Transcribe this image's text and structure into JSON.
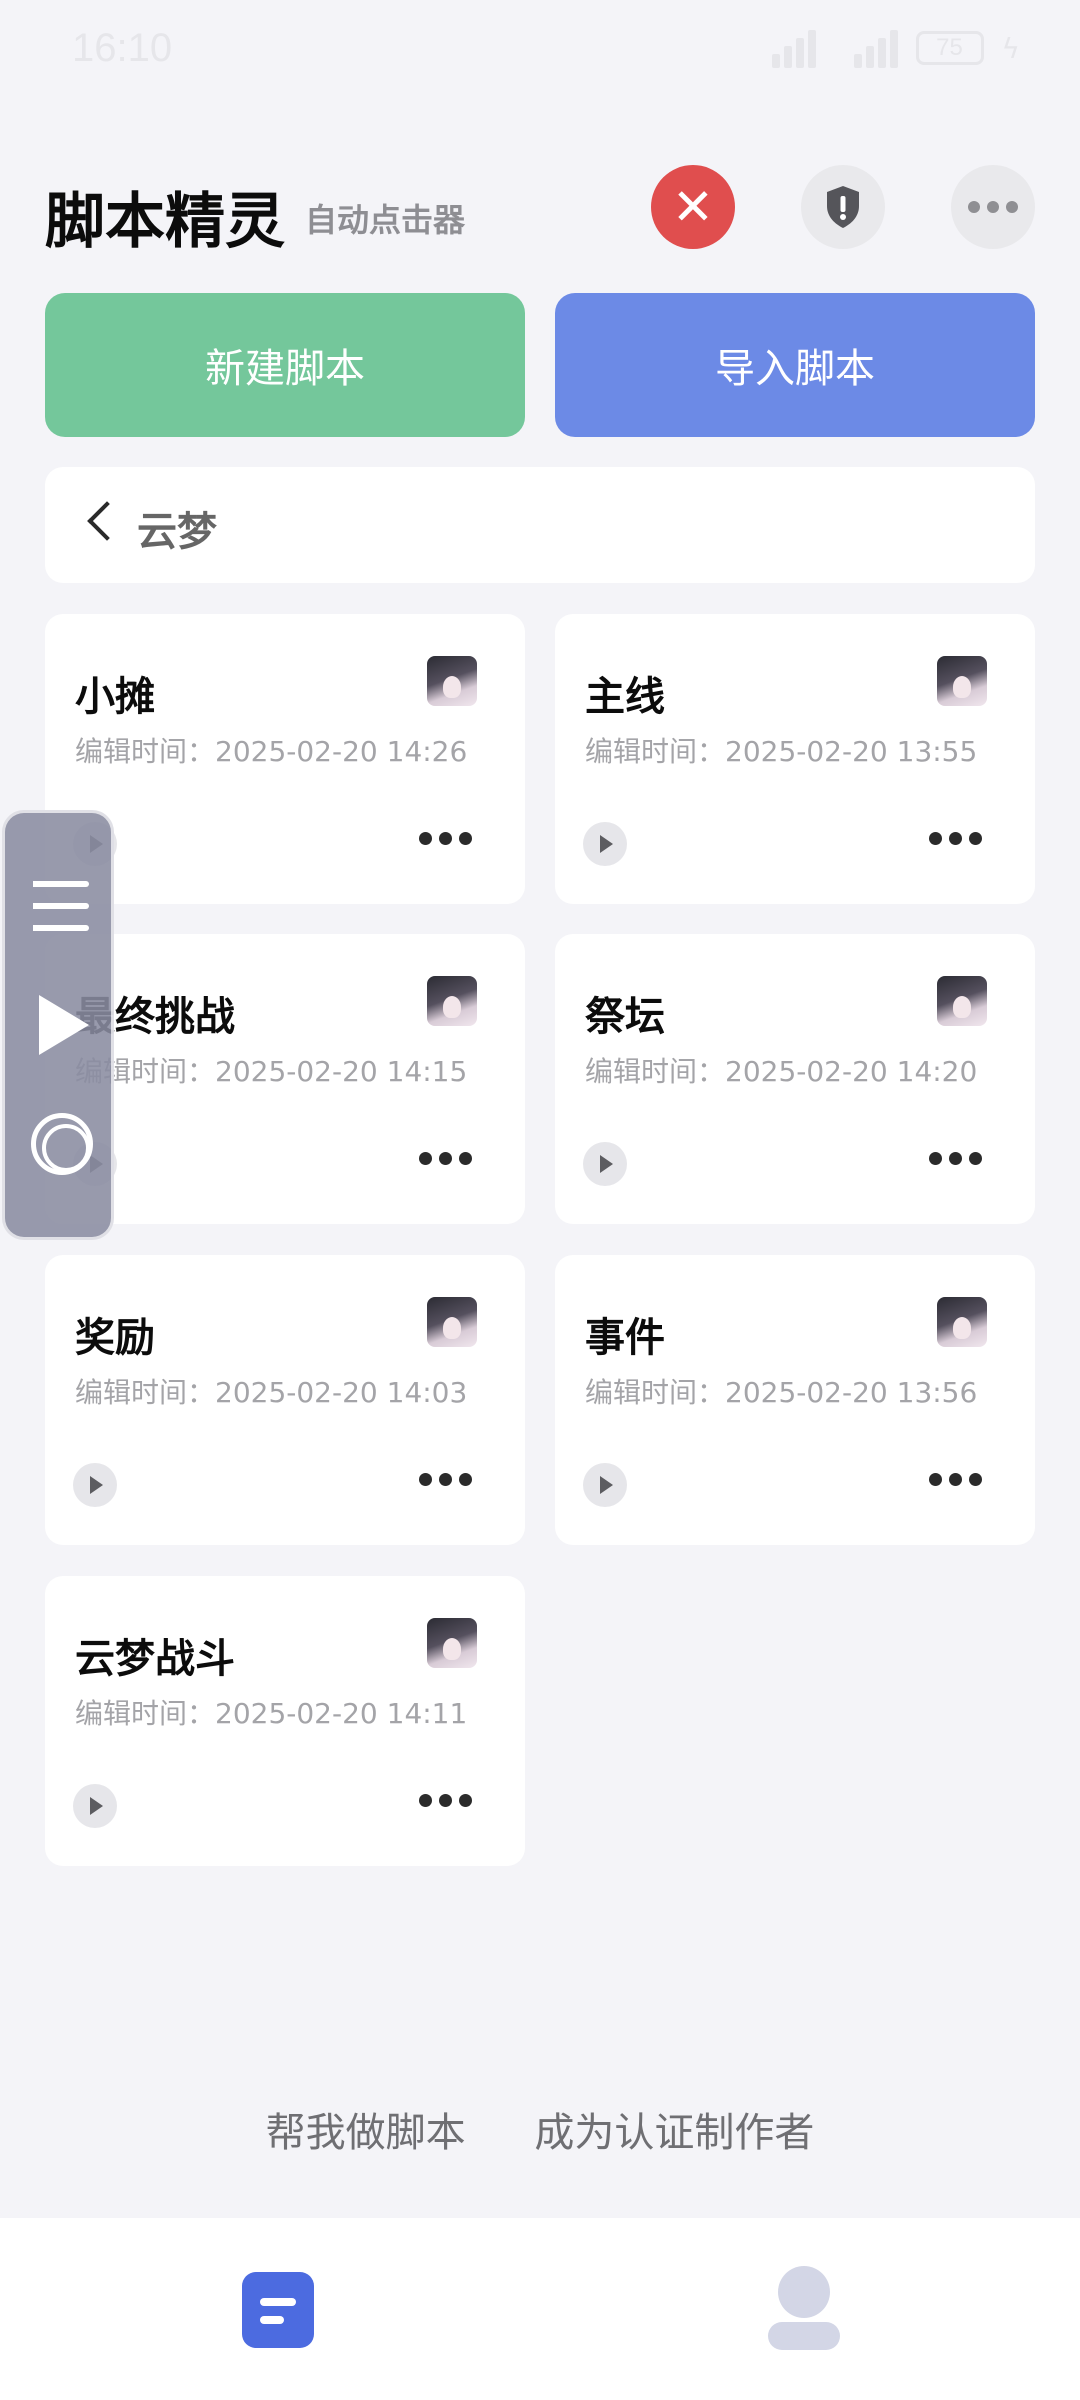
{
  "status_bar": {
    "time": "16:10",
    "battery": "75"
  },
  "header": {
    "title": "脚本精灵",
    "subtitle": "自动点击器"
  },
  "actions": {
    "new_script": "新建脚本",
    "import_script": "导入脚本"
  },
  "folder": {
    "name": "云梦"
  },
  "cards": [
    {
      "title": "小摊",
      "time": "编辑时间：2025-02-20 14:26"
    },
    {
      "title": "主线",
      "time": "编辑时间：2025-02-20 13:55"
    },
    {
      "title": "最终挑战",
      "time": "编辑时间：2025-02-20 14:15"
    },
    {
      "title": "祭坛",
      "time": "编辑时间：2025-02-20 14:20"
    },
    {
      "title": "奖励",
      "time": "编辑时间：2025-02-20 14:03"
    },
    {
      "title": "事件",
      "time": "编辑时间：2025-02-20 13:56"
    },
    {
      "title": "云梦战斗",
      "time": "编辑时间：2025-02-20 14:11"
    }
  ],
  "footer": {
    "help_make": "帮我做脚本",
    "become_author": "成为认证制作者"
  },
  "colors": {
    "new_button": "#74c79b",
    "import_button": "#6c8ae6",
    "close_button": "#e04e4e",
    "nav_active": "#4c6be0"
  },
  "icons": [
    "close-icon",
    "shield-alert-icon",
    "more-icon",
    "back-icon",
    "play-icon",
    "list-icon",
    "record-icon",
    "document-icon",
    "profile-icon"
  ]
}
